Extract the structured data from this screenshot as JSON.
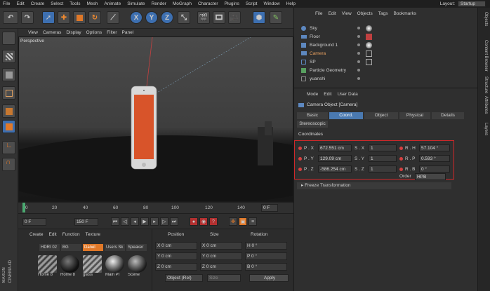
{
  "menubar": {
    "items": [
      "File",
      "Edit",
      "Create",
      "Select",
      "Tools",
      "Mesh",
      "Animate",
      "Simulate",
      "Render",
      "MoGraph",
      "Character",
      "Plugins",
      "Script",
      "Window",
      "Help"
    ],
    "layout_label": "Layout:",
    "layout_value": "Startup"
  },
  "toolbar": {
    "axis_x": "X",
    "axis_y": "Y",
    "axis_z": "Z"
  },
  "viewport": {
    "menu": [
      "View",
      "Cameras",
      "Display",
      "Options",
      "Filter",
      "Panel"
    ],
    "label": "Perspective"
  },
  "timeline": {
    "ticks": [
      "0",
      "20",
      "40",
      "60",
      "80",
      "100",
      "120",
      "140"
    ],
    "end_field": "0 F"
  },
  "playback": {
    "start_field": "0 F",
    "end_field": "150 F"
  },
  "material_manager": {
    "menu": [
      "Create",
      "Edit",
      "Function",
      "Texture"
    ],
    "tabs": [
      "HDRI 02",
      "BG",
      "Danel",
      "Users Sk",
      "Speaker"
    ],
    "selected_tab": "Danel",
    "materials": [
      "Home 8",
      "Home 8",
      "glass",
      "Main Pl",
      "Scene"
    ],
    "brand_top": "MAXON",
    "brand_bottom": "CINEMA 4D"
  },
  "coordinates_panel": {
    "headers": [
      "Position",
      "Size",
      "Rotation"
    ],
    "rows": [
      {
        "pos_axis": "X",
        "pos": "0 cm",
        "size_axis": "X",
        "size": "0 cm",
        "rot_axis": "H",
        "rot": "0 °"
      },
      {
        "pos_axis": "Y",
        "pos": "0 cm",
        "size_axis": "Y",
        "size": "0 cm",
        "rot_axis": "P",
        "rot": "0 °"
      },
      {
        "pos_axis": "Z",
        "pos": "0 cm",
        "size_axis": "Z",
        "size": "0 cm",
        "rot_axis": "B",
        "rot": "0 °"
      }
    ],
    "mode_select": "Object (Rel)",
    "size_select": "Size",
    "apply_label": "Apply"
  },
  "object_manager": {
    "menu": [
      "File",
      "Edit",
      "View",
      "Objects",
      "Tags",
      "Bookmarks"
    ],
    "objects": [
      "Sky",
      "Floor",
      "Background 1",
      "Camera",
      "SP",
      "Particle Geometry",
      "yuanshi"
    ]
  },
  "attributes": {
    "menu": [
      "Mode",
      "Edit",
      "User Data"
    ],
    "title": "Camera Object [Camera]",
    "tabs": [
      "Basic",
      "Coord.",
      "Object",
      "Physical",
      "Details"
    ],
    "selected_tab": "Coord.",
    "tab2": "Stereoscopic",
    "section": "Coordinates",
    "rows": [
      {
        "p_label": "P . X",
        "p_val": "672.551 cm",
        "s_label": "S . X",
        "s_val": "1",
        "r_label": "R . H",
        "r_val": "57.104 °"
      },
      {
        "p_label": "P . Y",
        "p_val": "129.09 cm",
        "s_label": "S . Y",
        "s_val": "1",
        "r_label": "R . P",
        "r_val": "0.593 °"
      },
      {
        "p_label": "P . Z",
        "p_val": "-586.254 cm",
        "s_label": "S . Z",
        "s_val": "1",
        "r_label": "R . B",
        "r_val": "0 °"
      }
    ],
    "order_label": "Order",
    "order_value": "HPB",
    "freeze": "▸ Freeze Transformation"
  },
  "side_tabs": [
    "Objects",
    "Content Browser",
    "Structure",
    "Attributes",
    "Layers"
  ],
  "colors": {
    "accent_orange": "#e07828",
    "selection_blue": "#4a79b0",
    "highlight_red": "#d0282a"
  }
}
